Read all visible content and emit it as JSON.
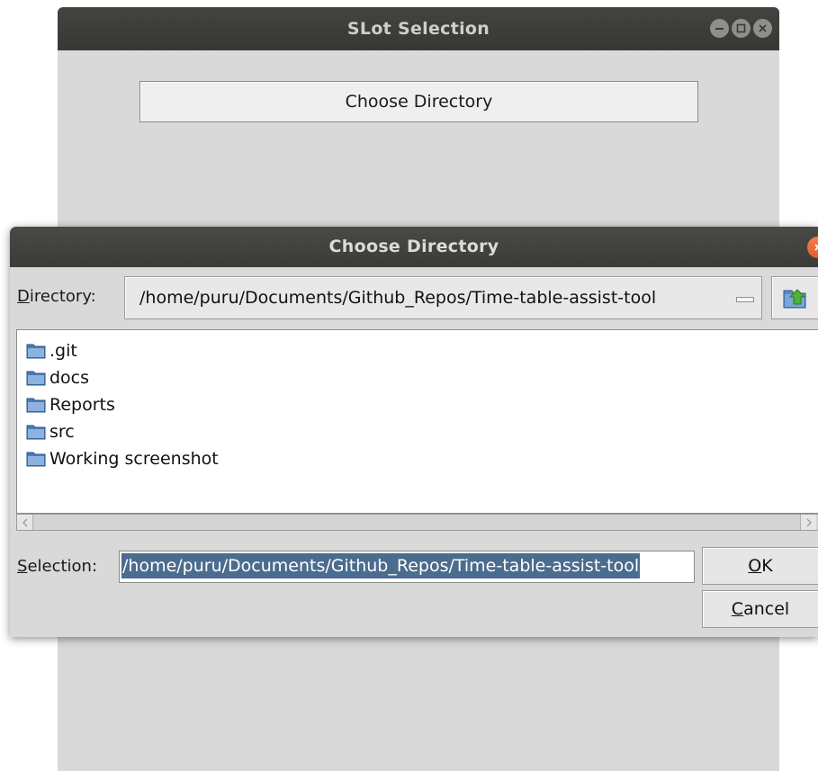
{
  "main_window": {
    "title": "SLot Selection",
    "choose_directory_button": "Choose Directory"
  },
  "dialog": {
    "title": "Choose Directory",
    "directory_label_accel": "D",
    "directory_label_rest": "irectory:",
    "directory_value": "/home/puru/Documents/Github_Repos/Time-table-assist-tool",
    "folders": [
      {
        "name": ".git"
      },
      {
        "name": "docs"
      },
      {
        "name": "Reports"
      },
      {
        "name": "src"
      },
      {
        "name": "Working screenshot"
      }
    ],
    "selection_label_accel": "S",
    "selection_label_rest": "election:",
    "selection_value": "/home/puru/Documents/Github_Repos/Time-table-assist-tool",
    "ok_label_accel": "O",
    "ok_label_rest": "K",
    "cancel_label_accel": "C",
    "cancel_label_rest": "ancel"
  },
  "colors": {
    "titlebar": "#3c3b37",
    "close_button": "#e35b2a",
    "selection_highlight": "#4a6c8e",
    "folder_icon": "#4a7ab8"
  },
  "icons": {
    "window_minimize": "minimize-icon",
    "window_maximize": "maximize-icon",
    "window_close": "close-icon",
    "up_folder": "up-folder-icon",
    "folder": "folder-icon"
  }
}
